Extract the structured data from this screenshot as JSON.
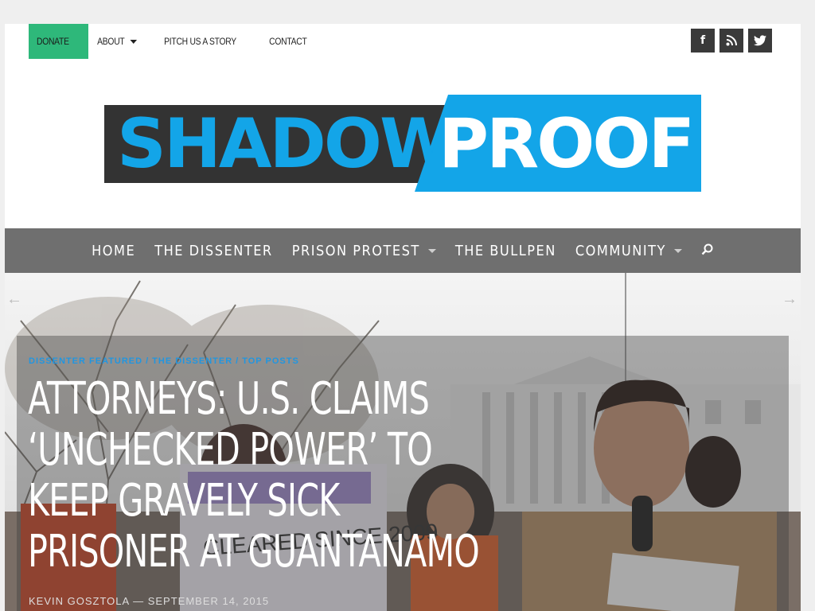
{
  "topnav": {
    "donate": "DONATE",
    "about": "ABOUT",
    "pitch": "PITCH US A STORY",
    "contact": "CONTACT"
  },
  "social": {
    "facebook": "f",
    "rss": "rss",
    "twitter": "twitter"
  },
  "logo": {
    "part1": "SHADOW",
    "part2": "PROOF"
  },
  "mainnav": {
    "home": "HOME",
    "dissenter": "THE DISSENTER",
    "prison": "PRISON PROTEST",
    "bullpen": "THE BULLPEN",
    "community": "COMMUNITY"
  },
  "hero": {
    "categories": [
      "DISSENTER FEATURED",
      "THE DISSENTER",
      "TOP POSTS"
    ],
    "headline_lines": [
      "ATTORNEYS: U.S. CLAIMS",
      "‘UNCHECKED POWER’ TO",
      "KEEP GRAVELY SICK",
      "PRISONER AT GUANTANAMO"
    ],
    "author": "KEVIN GOSZTOLA",
    "dash": "—",
    "date": "SEPTEMBER 14, 2015",
    "sign_lines": [
      "CLEARED SINCE 2009"
    ]
  },
  "colors": {
    "accent": "#13a5e8",
    "donate": "#2eb87a",
    "nav": "#6f6f6f"
  }
}
